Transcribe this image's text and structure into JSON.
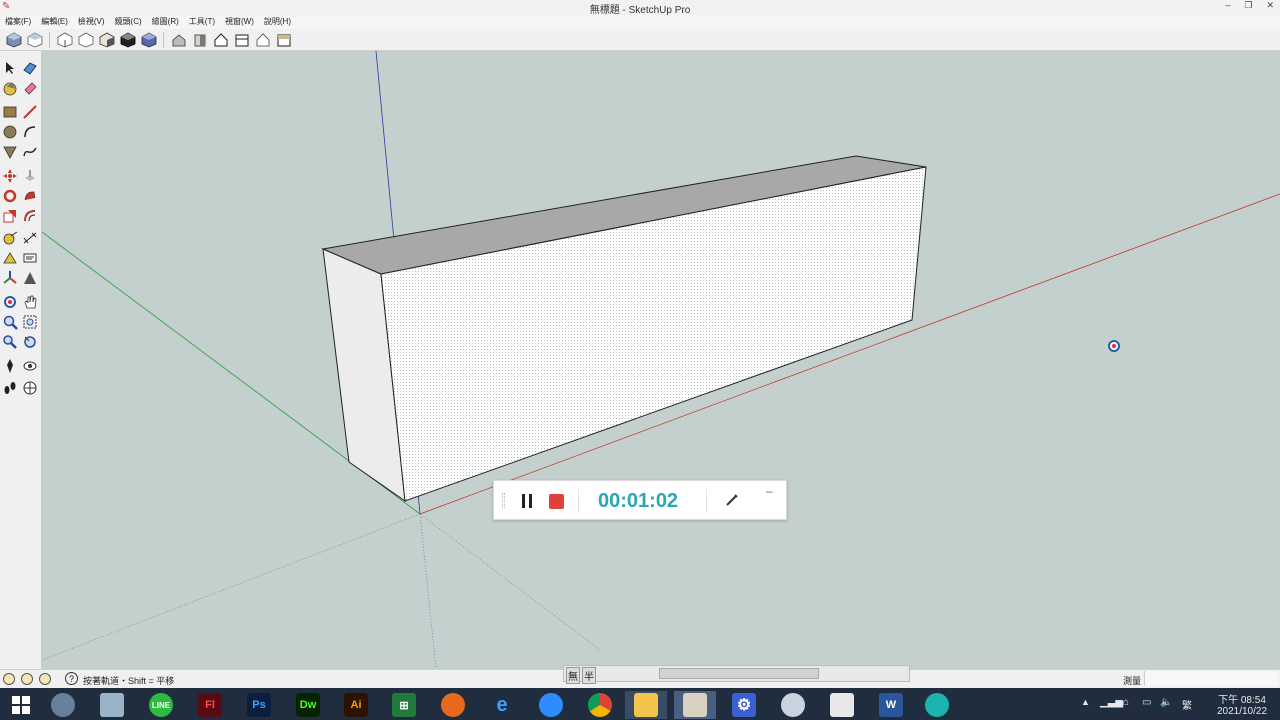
{
  "window": {
    "title": "無標題 - SketchUp Pro",
    "controls": [
      "–",
      "❐",
      "✕"
    ]
  },
  "menu": [
    "檔案(F)",
    "編輯(E)",
    "檢視(V)",
    "鏡頭(C)",
    "繪圖(R)",
    "工具(T)",
    "視窗(W)",
    "說明(H)"
  ],
  "recorder": {
    "time": "00:01:02",
    "minimize": "–"
  },
  "status": {
    "hint": "按著軌道・Shift = 平移",
    "measure_label": "測量",
    "measure_value": ""
  },
  "scroll_tabs": [
    "無",
    "半"
  ],
  "taskbar": {
    "apps": [
      {
        "name": "windows-start",
        "label": ""
      },
      {
        "name": "app-search",
        "label": ""
      },
      {
        "name": "app-sketch",
        "label": ""
      },
      {
        "name": "app-line",
        "label": "LINE"
      },
      {
        "name": "app-flash",
        "label": "Fl"
      },
      {
        "name": "app-photoshop",
        "label": "Ps"
      },
      {
        "name": "app-dreamweaver",
        "label": "Dw"
      },
      {
        "name": "app-illustrator",
        "label": "Ai"
      },
      {
        "name": "app-excel",
        "label": "⊞"
      },
      {
        "name": "app-firefox",
        "label": ""
      },
      {
        "name": "app-ie",
        "label": "e"
      },
      {
        "name": "app-zoom",
        "label": ""
      },
      {
        "name": "app-chrome",
        "label": ""
      },
      {
        "name": "app-explorer",
        "label": ""
      },
      {
        "name": "app-sketchup",
        "label": ""
      },
      {
        "name": "app-settings",
        "label": "⚙"
      },
      {
        "name": "app-sketchup2",
        "label": ""
      },
      {
        "name": "app-acrobat",
        "label": ""
      },
      {
        "name": "app-word",
        "label": "W"
      },
      {
        "name": "app-recorder",
        "label": ""
      }
    ],
    "ime": "繁",
    "clock_time": "下午 08:54",
    "clock_date": "2021/10/22"
  },
  "colors": {
    "accent_timer": "#2aa6b5",
    "stop": "#e0403a",
    "taskbar": "#1f2d3f",
    "viewport": "#c3d0cd"
  }
}
